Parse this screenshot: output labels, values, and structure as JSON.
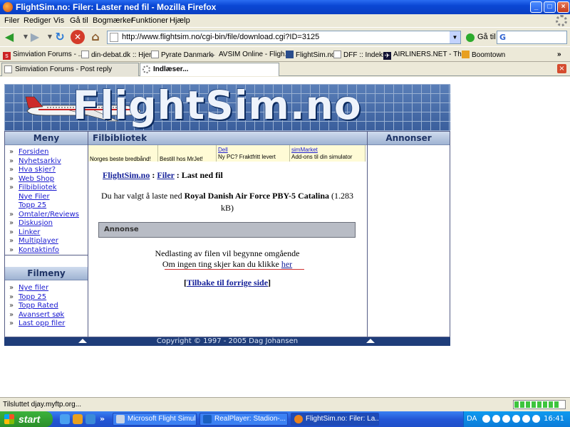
{
  "window": {
    "title": "FlightSim.no: Filer: Laster ned fil - Mozilla Firefox"
  },
  "menu": [
    "Filer",
    "Rediger",
    "Vis",
    "Gå til",
    "Bogmærker",
    "Funktioner",
    "Hjælp"
  ],
  "nav": {
    "url": "http://www.flightsim.no/cgi-bin/file/download.cgi?ID=3125",
    "go_label": "Gå til"
  },
  "bookmarks": [
    "Simviation Forums - ...",
    "din-debat.dk :: Hjem",
    "Pyrate Danmark",
    "AVSIM Online - Fligh...",
    "FlightSim.no",
    "DFF :: Indeks",
    "AIRLINERS.NET - Th...",
    "Boomtown"
  ],
  "tabs": [
    "Simviation Forums - Post reply",
    "Indlæser..."
  ],
  "site": {
    "logo": "FlightSim.no",
    "menu_head": "Meny",
    "menu_items": [
      {
        "label": "Forsiden",
        "sub": false
      },
      {
        "label": "Nyhetsarkiv",
        "sub": false
      },
      {
        "label": "Hva skjer?",
        "sub": false
      },
      {
        "label": "Web Shop",
        "sub": false
      },
      {
        "label": "Filbibliotek",
        "sub": false
      },
      {
        "label": "Nye Filer",
        "sub": true
      },
      {
        "label": "Topp 25",
        "sub": true
      },
      {
        "label": "Omtaler/Reviews",
        "sub": false
      },
      {
        "label": "Diskusjon",
        "sub": false
      },
      {
        "label": "Linker",
        "sub": false
      },
      {
        "label": "Multiplayer",
        "sub": false
      },
      {
        "label": "Kontaktinfo",
        "sub": false
      }
    ],
    "filmeny_head": "Filmeny",
    "filmeny_items": [
      "Nye filer",
      "Topp 25",
      "Topp Rated",
      "Avansert søk",
      "Last opp filer"
    ],
    "main_head": "Filbibliotek",
    "right_head": "Annonser",
    "ads": [
      {
        "link": "",
        "text": "Norges beste bredbånd!"
      },
      {
        "link": "",
        "text": "Bestill hos MrJet!"
      },
      {
        "link": "Dell",
        "text": "Ny PC? Fraktfritt levert"
      },
      {
        "link": "simMarket",
        "text": "Add-ons til din simulator"
      }
    ],
    "crumb_home": "FlightSim.no",
    "crumb_files": "Filer",
    "crumb_current": "Last ned fil",
    "dl_prefix": "Du har valgt å laste ned",
    "dl_file": "Royal Danish Air Force PBY-5 Catalina",
    "dl_size": "(1.283 kB)",
    "annonse_label": "Annonse",
    "start_text": "Nedlasting av filen vil begynne omgående",
    "click_text": "Om ingen ting skjer kan du klikke",
    "click_link": "her",
    "back_link": "Tilbake til forrige side",
    "footer": "Copyright © 1997 - 2005 Dag Johansen"
  },
  "status": {
    "text": "Tilsluttet djay.myftp.org...",
    "progress": 0.9
  },
  "taskbar": {
    "start": "start",
    "tasks": [
      "Microsoft Flight Simul...",
      "RealPlayer: Stadion-...",
      "FlightSim.no: Filer: La..."
    ],
    "lang": "DA",
    "clock": "16:41"
  },
  "colors": {
    "titlebar": "#0a47d4",
    "site_header": "#9fb3d2",
    "footer": "#1f3d7a",
    "link": "#1a1ad0"
  }
}
